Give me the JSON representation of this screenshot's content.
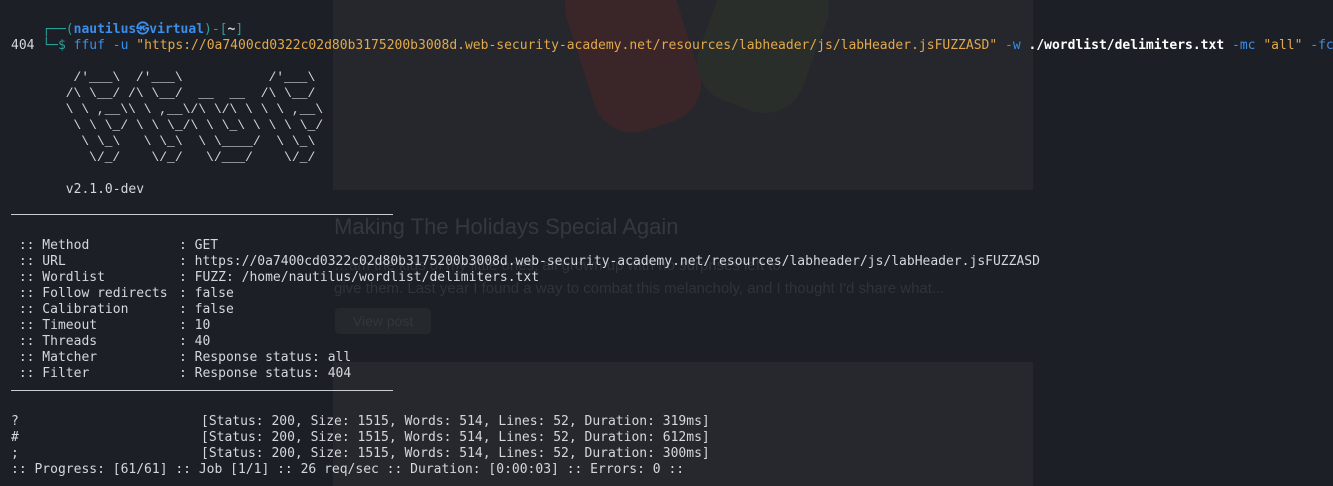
{
  "background_page": {
    "post_title": "Making The Holidays Special Again",
    "post_excerpt_line1": "…am the kids of my little ones, all grown up with no surprises left to",
    "post_excerpt_line2": "give them. Last year I found a way to combat this melancholy, and I thought I'd share what...",
    "view_post_label": "View post"
  },
  "terminal": {
    "prompt": {
      "frame_top": "┌──(",
      "user_host": "nautilus㉿virtual",
      "frame_mid": ")-[",
      "dir": "~",
      "frame_end": "]",
      "frame_bottom": "└─$ "
    },
    "command": {
      "bin": "ffuf",
      "flag_u": " -u ",
      "url_arg": "\"https://0a7400cd0322c02d80b3175200b3008d.web-security-academy.net/resources/labheader/js/labHeader.jsFUZZASD\"",
      "flag_w": " -w ",
      "wordlist_arg": "./wordlist/delimiters.txt",
      "flag_mc": " -mc ",
      "mc_arg": "\"all\"",
      "flag_fc": " -fc"
    },
    "wrapped_tail": "404",
    "banner_ascii": "        /'___\\  /'___\\           /'___\\       \n       /\\ \\__/ /\\ \\__/  __  __  /\\ \\__/       \n       \\ \\ ,__\\\\ \\ ,__\\/\\ \\/\\ \\ \\ \\ ,__\\      \n        \\ \\ \\_/ \\ \\ \\_/\\ \\ \\_\\ \\ \\ \\ \\_/      \n         \\ \\_\\   \\ \\_\\  \\ \\____/  \\ \\_\\       \n          \\/_/    \\/_/   \\/___/    \\/_/       ",
    "version": "       v2.1.0-dev",
    "config": [
      {
        "key": " :: Method           ",
        "value": ": GET"
      },
      {
        "key": " :: URL              ",
        "value": ": https://0a7400cd0322c02d80b3175200b3008d.web-security-academy.net/resources/labheader/js/labHeader.jsFUZZASD"
      },
      {
        "key": " :: Wordlist         ",
        "value": ": FUZZ: /home/nautilus/wordlist/delimiters.txt"
      },
      {
        "key": " :: Follow redirects ",
        "value": ": false"
      },
      {
        "key": " :: Calibration      ",
        "value": ": false"
      },
      {
        "key": " :: Timeout          ",
        "value": ": 10"
      },
      {
        "key": " :: Threads          ",
        "value": ": 40"
      },
      {
        "key": " :: Matcher          ",
        "value": ": Response status: all"
      },
      {
        "key": " :: Filter           ",
        "value": ": Response status: 404"
      }
    ],
    "results": [
      {
        "word": "?",
        "stats": "[Status: 200, Size: 1515, Words: 514, Lines: 52, Duration: 319ms]"
      },
      {
        "word": "#",
        "stats": "[Status: 200, Size: 1515, Words: 514, Lines: 52, Duration: 612ms]"
      },
      {
        "word": ";",
        "stats": "[Status: 200, Size: 1515, Words: 514, Lines: 52, Duration: 300ms]"
      }
    ],
    "progress": ":: Progress: [61/61] :: Job [1/1] :: 26 req/sec :: Duration: [0:00:03] :: Errors: 0 ::"
  },
  "colors": {
    "background": "#1c1f26",
    "prompt_blue": "#3b8eea",
    "prompt_frame": "#2aa198",
    "string_orange": "#e3a84a",
    "text": "#d4d7dc"
  }
}
